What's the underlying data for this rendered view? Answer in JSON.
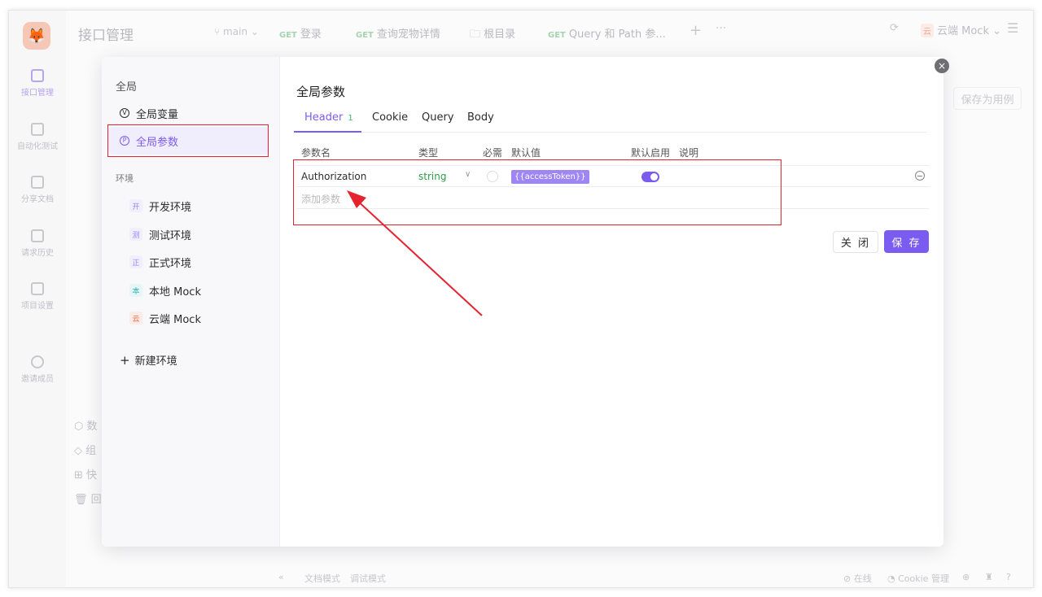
{
  "app": {
    "title": "接口管理",
    "branch": "main",
    "tabs": [
      {
        "method": "GET",
        "label": "登录"
      },
      {
        "method": "GET",
        "label": "查询宠物详情"
      },
      {
        "method": "",
        "label": "根目录"
      },
      {
        "method": "GET",
        "label": "Query 和 Path 参..."
      }
    ],
    "environment": {
      "badge": "云",
      "label": "云端 Mock"
    },
    "rail": [
      "接口管理",
      "自动化测试",
      "分享文档",
      "请求历史",
      "项目设置",
      "邀请成员"
    ],
    "save_case_label": "保存为用例",
    "bottom": {
      "doc_mode": "文档模式",
      "debug_mode": "调试模式",
      "online": "在线",
      "cookie": "Cookie 管理"
    },
    "bg_sidebar": [
      "数",
      "组",
      "快",
      "回"
    ]
  },
  "modal": {
    "side_heading": "全局",
    "items": [
      {
        "icon": "V",
        "label": "全局变量"
      },
      {
        "icon": "P",
        "label": "全局参数"
      }
    ],
    "env_section": "环境",
    "envs": [
      {
        "badge": "开",
        "label": "开发环境",
        "color": "#7b5cf0"
      },
      {
        "badge": "测",
        "label": "测试环境",
        "color": "#7b5cf0"
      },
      {
        "badge": "正",
        "label": "正式环境",
        "color": "#7b5cf0"
      },
      {
        "badge": "本",
        "label": "本地 Mock",
        "color": "#2bb3b3"
      },
      {
        "badge": "云",
        "label": "云端 Mock",
        "color": "#e8714f"
      }
    ],
    "new_env_label": "新建环境",
    "title": "全局参数",
    "tabs": [
      {
        "label": "Header",
        "count": "1"
      },
      {
        "label": "Cookie"
      },
      {
        "label": "Query"
      },
      {
        "label": "Body"
      }
    ],
    "table": {
      "headers": {
        "name": "参数名",
        "type": "类型",
        "required": "必需",
        "default": "默认值",
        "enabled": "默认启用",
        "desc": "说明"
      },
      "rows": [
        {
          "name": "Authorization",
          "type": "string",
          "default": "{{accessToken}}",
          "enabled": true
        }
      ],
      "add_placeholder": "添加参数"
    },
    "close_label": "关 闭",
    "save_label": "保 存"
  },
  "colors": {
    "accent": "#7b5cf0",
    "annotation": "#e5232f"
  }
}
